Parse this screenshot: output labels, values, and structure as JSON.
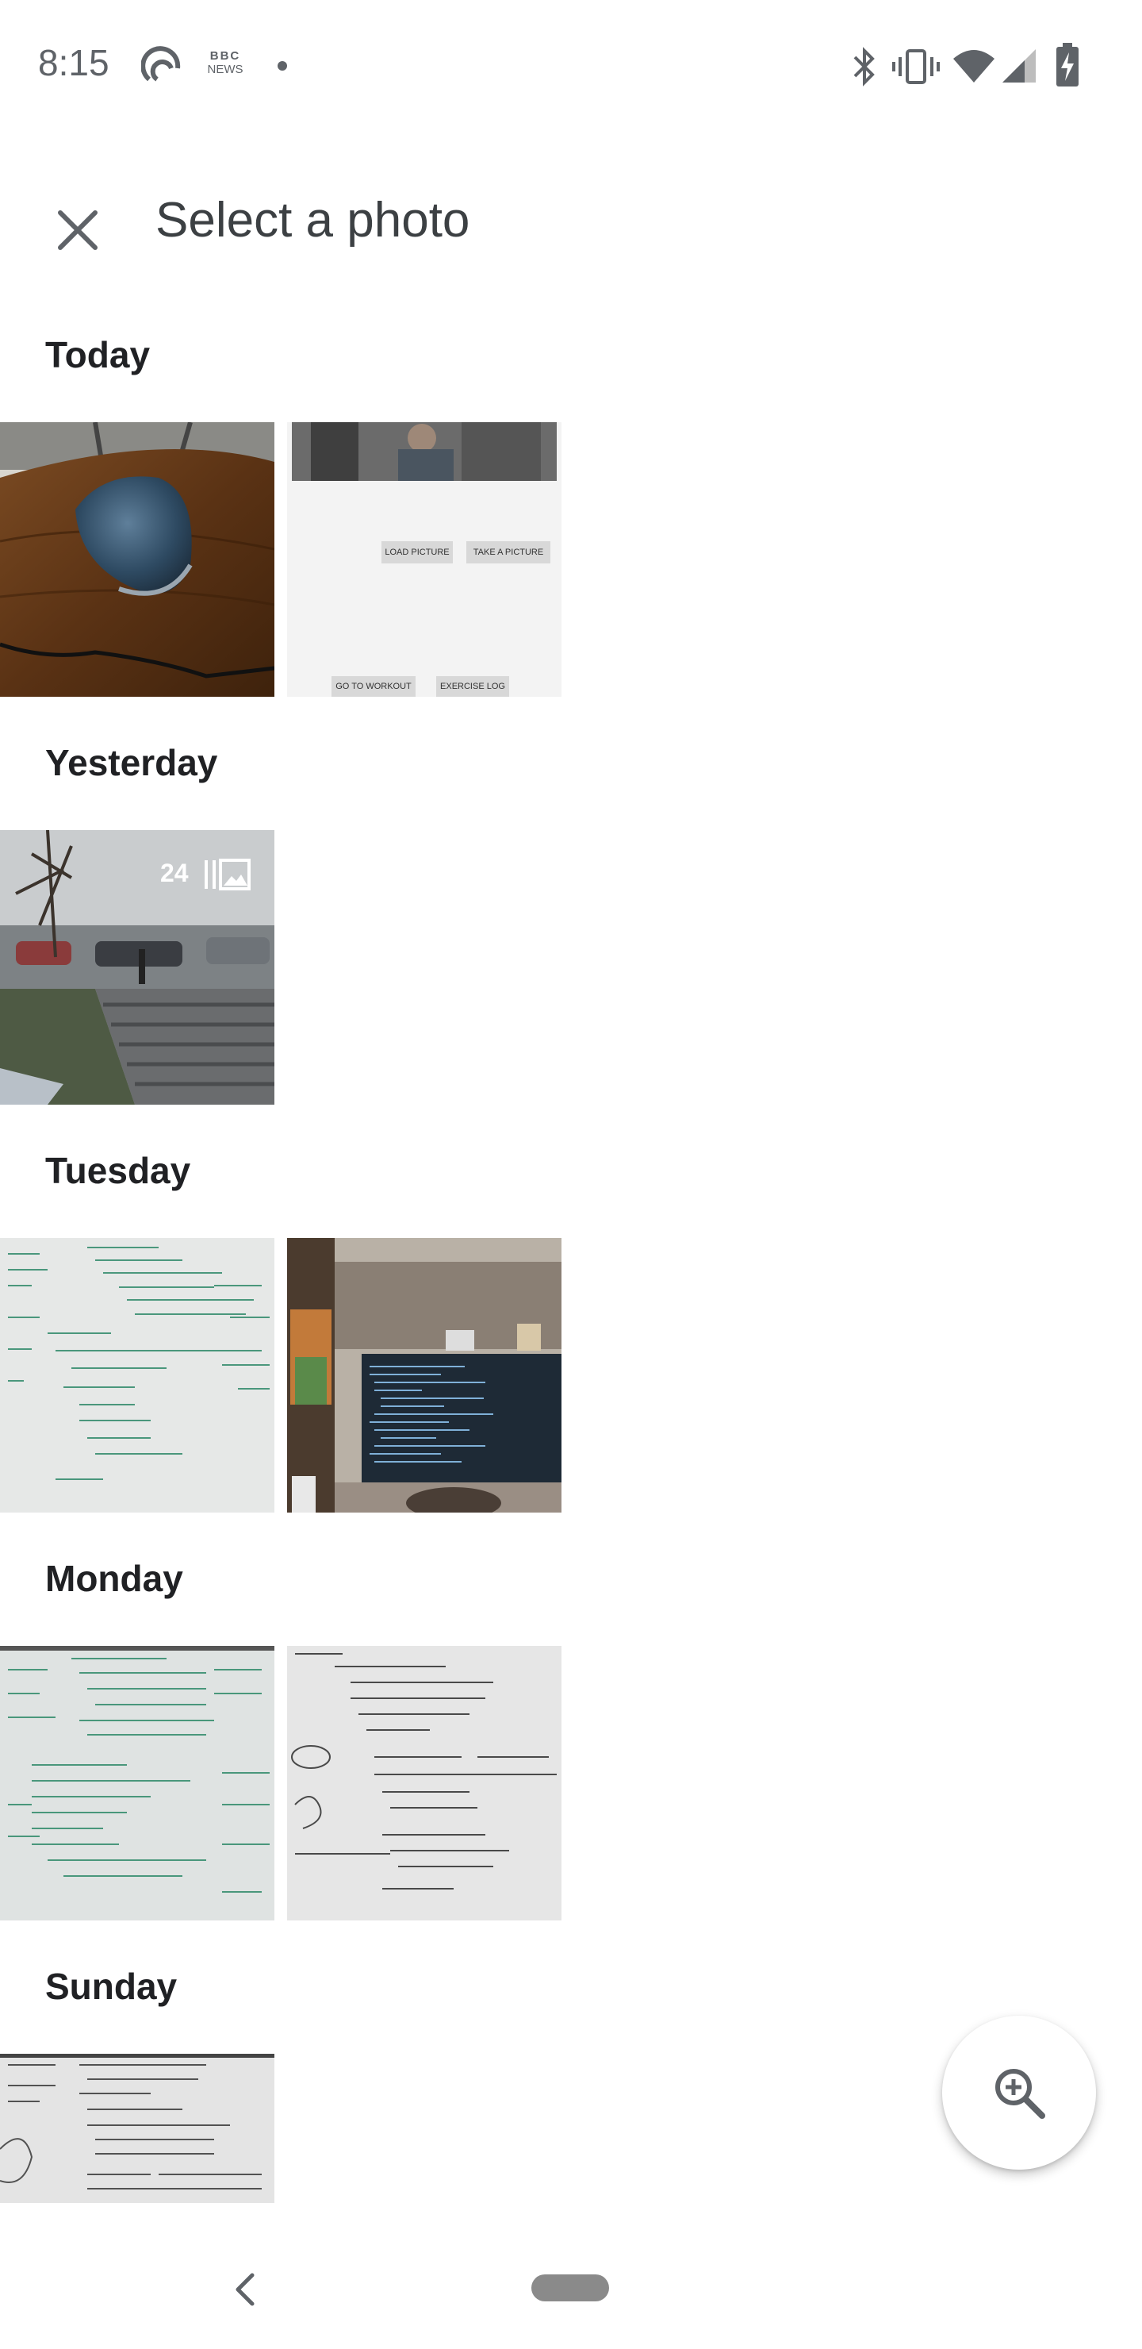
{
  "status_bar": {
    "time": "8:15",
    "news_badge_line1": "BBC",
    "news_badge_line2": "NEWS",
    "icons": [
      "sync-icon",
      "bbc-news-icon",
      "notification-dot-icon",
      "bluetooth-icon",
      "vibrate-icon",
      "wifi-icon",
      "cell-signal-icon",
      "battery-charging-icon"
    ]
  },
  "app_bar": {
    "close_icon": "close-icon",
    "title": "Select a photo"
  },
  "sections": [
    {
      "title": "Today",
      "photos": [
        {
          "subject": "mouse-on-wooden-table"
        },
        {
          "subject": "app-screenshot",
          "buttons": [
            "LOAD PICTURE",
            "TAKE A PICTURE",
            "GO TO WORKOUT",
            "EXERCISE LOG"
          ]
        }
      ]
    },
    {
      "title": "Yesterday",
      "photos": [
        {
          "subject": "rainy-parking-lot-burst",
          "burst_count": "24",
          "burst_icon": "burst-photos-icon"
        }
      ]
    },
    {
      "title": "Tuesday",
      "photos": [
        {
          "subject": "whiteboard-notes"
        },
        {
          "subject": "laptop-with-code"
        }
      ]
    },
    {
      "title": "Monday",
      "photos": [
        {
          "subject": "whiteboard-notes"
        },
        {
          "subject": "whiteboard-notes"
        }
      ]
    },
    {
      "title": "Sunday",
      "photos": [
        {
          "subject": "whiteboard-notes"
        }
      ]
    }
  ],
  "fab": {
    "icon": "zoom-in-icon"
  },
  "nav_bar": {
    "back_icon": "back-icon",
    "home_icon": "home-pill-icon"
  }
}
